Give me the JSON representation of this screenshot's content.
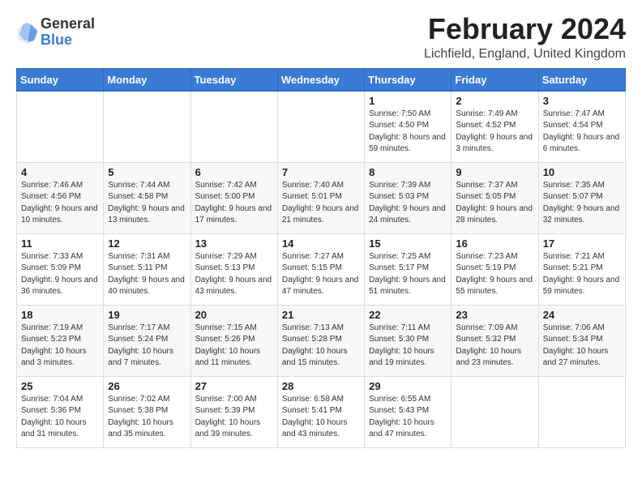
{
  "header": {
    "logo_general": "General",
    "logo_blue": "Blue",
    "month_year": "February 2024",
    "location": "Lichfield, England, United Kingdom"
  },
  "weekdays": [
    "Sunday",
    "Monday",
    "Tuesday",
    "Wednesday",
    "Thursday",
    "Friday",
    "Saturday"
  ],
  "weeks": [
    [
      {
        "day": "",
        "sunrise": "",
        "sunset": "",
        "daylight": ""
      },
      {
        "day": "",
        "sunrise": "",
        "sunset": "",
        "daylight": ""
      },
      {
        "day": "",
        "sunrise": "",
        "sunset": "",
        "daylight": ""
      },
      {
        "day": "",
        "sunrise": "",
        "sunset": "",
        "daylight": ""
      },
      {
        "day": "1",
        "sunrise": "Sunrise: 7:50 AM",
        "sunset": "Sunset: 4:50 PM",
        "daylight": "Daylight: 8 hours and 59 minutes."
      },
      {
        "day": "2",
        "sunrise": "Sunrise: 7:49 AM",
        "sunset": "Sunset: 4:52 PM",
        "daylight": "Daylight: 9 hours and 3 minutes."
      },
      {
        "day": "3",
        "sunrise": "Sunrise: 7:47 AM",
        "sunset": "Sunset: 4:54 PM",
        "daylight": "Daylight: 9 hours and 6 minutes."
      }
    ],
    [
      {
        "day": "4",
        "sunrise": "Sunrise: 7:46 AM",
        "sunset": "Sunset: 4:56 PM",
        "daylight": "Daylight: 9 hours and 10 minutes."
      },
      {
        "day": "5",
        "sunrise": "Sunrise: 7:44 AM",
        "sunset": "Sunset: 4:58 PM",
        "daylight": "Daylight: 9 hours and 13 minutes."
      },
      {
        "day": "6",
        "sunrise": "Sunrise: 7:42 AM",
        "sunset": "Sunset: 5:00 PM",
        "daylight": "Daylight: 9 hours and 17 minutes."
      },
      {
        "day": "7",
        "sunrise": "Sunrise: 7:40 AM",
        "sunset": "Sunset: 5:01 PM",
        "daylight": "Daylight: 9 hours and 21 minutes."
      },
      {
        "day": "8",
        "sunrise": "Sunrise: 7:39 AM",
        "sunset": "Sunset: 5:03 PM",
        "daylight": "Daylight: 9 hours and 24 minutes."
      },
      {
        "day": "9",
        "sunrise": "Sunrise: 7:37 AM",
        "sunset": "Sunset: 5:05 PM",
        "daylight": "Daylight: 9 hours and 28 minutes."
      },
      {
        "day": "10",
        "sunrise": "Sunrise: 7:35 AM",
        "sunset": "Sunset: 5:07 PM",
        "daylight": "Daylight: 9 hours and 32 minutes."
      }
    ],
    [
      {
        "day": "11",
        "sunrise": "Sunrise: 7:33 AM",
        "sunset": "Sunset: 5:09 PM",
        "daylight": "Daylight: 9 hours and 36 minutes."
      },
      {
        "day": "12",
        "sunrise": "Sunrise: 7:31 AM",
        "sunset": "Sunset: 5:11 PM",
        "daylight": "Daylight: 9 hours and 40 minutes."
      },
      {
        "day": "13",
        "sunrise": "Sunrise: 7:29 AM",
        "sunset": "Sunset: 5:13 PM",
        "daylight": "Daylight: 9 hours and 43 minutes."
      },
      {
        "day": "14",
        "sunrise": "Sunrise: 7:27 AM",
        "sunset": "Sunset: 5:15 PM",
        "daylight": "Daylight: 9 hours and 47 minutes."
      },
      {
        "day": "15",
        "sunrise": "Sunrise: 7:25 AM",
        "sunset": "Sunset: 5:17 PM",
        "daylight": "Daylight: 9 hours and 51 minutes."
      },
      {
        "day": "16",
        "sunrise": "Sunrise: 7:23 AM",
        "sunset": "Sunset: 5:19 PM",
        "daylight": "Daylight: 9 hours and 55 minutes."
      },
      {
        "day": "17",
        "sunrise": "Sunrise: 7:21 AM",
        "sunset": "Sunset: 5:21 PM",
        "daylight": "Daylight: 9 hours and 59 minutes."
      }
    ],
    [
      {
        "day": "18",
        "sunrise": "Sunrise: 7:19 AM",
        "sunset": "Sunset: 5:23 PM",
        "daylight": "Daylight: 10 hours and 3 minutes."
      },
      {
        "day": "19",
        "sunrise": "Sunrise: 7:17 AM",
        "sunset": "Sunset: 5:24 PM",
        "daylight": "Daylight: 10 hours and 7 minutes."
      },
      {
        "day": "20",
        "sunrise": "Sunrise: 7:15 AM",
        "sunset": "Sunset: 5:26 PM",
        "daylight": "Daylight: 10 hours and 11 minutes."
      },
      {
        "day": "21",
        "sunrise": "Sunrise: 7:13 AM",
        "sunset": "Sunset: 5:28 PM",
        "daylight": "Daylight: 10 hours and 15 minutes."
      },
      {
        "day": "22",
        "sunrise": "Sunrise: 7:11 AM",
        "sunset": "Sunset: 5:30 PM",
        "daylight": "Daylight: 10 hours and 19 minutes."
      },
      {
        "day": "23",
        "sunrise": "Sunrise: 7:09 AM",
        "sunset": "Sunset: 5:32 PM",
        "daylight": "Daylight: 10 hours and 23 minutes."
      },
      {
        "day": "24",
        "sunrise": "Sunrise: 7:06 AM",
        "sunset": "Sunset: 5:34 PM",
        "daylight": "Daylight: 10 hours and 27 minutes."
      }
    ],
    [
      {
        "day": "25",
        "sunrise": "Sunrise: 7:04 AM",
        "sunset": "Sunset: 5:36 PM",
        "daylight": "Daylight: 10 hours and 31 minutes."
      },
      {
        "day": "26",
        "sunrise": "Sunrise: 7:02 AM",
        "sunset": "Sunset: 5:38 PM",
        "daylight": "Daylight: 10 hours and 35 minutes."
      },
      {
        "day": "27",
        "sunrise": "Sunrise: 7:00 AM",
        "sunset": "Sunset: 5:39 PM",
        "daylight": "Daylight: 10 hours and 39 minutes."
      },
      {
        "day": "28",
        "sunrise": "Sunrise: 6:58 AM",
        "sunset": "Sunset: 5:41 PM",
        "daylight": "Daylight: 10 hours and 43 minutes."
      },
      {
        "day": "29",
        "sunrise": "Sunrise: 6:55 AM",
        "sunset": "Sunset: 5:43 PM",
        "daylight": "Daylight: 10 hours and 47 minutes."
      },
      {
        "day": "",
        "sunrise": "",
        "sunset": "",
        "daylight": ""
      },
      {
        "day": "",
        "sunrise": "",
        "sunset": "",
        "daylight": ""
      }
    ]
  ]
}
